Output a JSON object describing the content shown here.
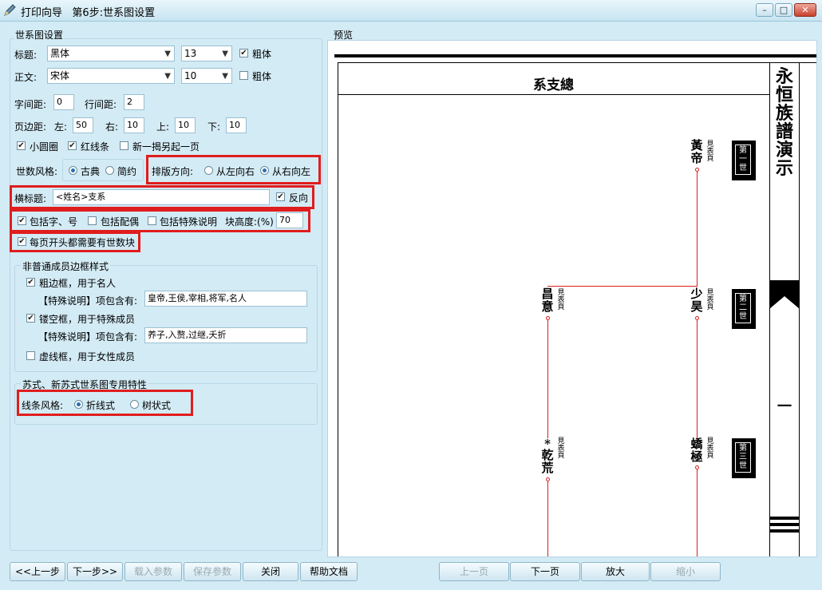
{
  "window": {
    "title": "打印向导",
    "step_title": "第6步:世系图设置",
    "minimize": "–",
    "maximize": "□",
    "close": "✕"
  },
  "settings": {
    "group_label": "世系图设置",
    "title_font": {
      "label": "标题:",
      "font": "黑体",
      "size": "13",
      "bold_label": "粗体",
      "bold": true
    },
    "body_font": {
      "label": "正文:",
      "font": "宋体",
      "size": "10",
      "bold_label": "粗体",
      "bold": false
    },
    "char_spacing": {
      "label": "字间距:",
      "value": "0"
    },
    "line_spacing": {
      "label": "行间距:",
      "value": "2"
    },
    "margins": {
      "label": "页边距:",
      "left_label": "左:",
      "left": "50",
      "right_label": "右:",
      "right": "10",
      "top_label": "上:",
      "top": "10",
      "bottom_label": "下:",
      "bottom": "10"
    },
    "small_circle": {
      "label": "小圆圈",
      "checked": true
    },
    "red_lines": {
      "label": "红线条",
      "checked": true
    },
    "new_page": {
      "label": "新一揭另起一页",
      "checked": false
    },
    "gen_style": {
      "label": "世数风格:",
      "opt1": "古典",
      "opt2": "简约",
      "selected": "古典"
    },
    "direction": {
      "label": "排版方向:",
      "opt1": "从左向右",
      "opt2": "从右向左",
      "selected": "从右向左"
    },
    "header": {
      "label": "横标题:",
      "value": "<姓名>支系",
      "reverse_label": "反向",
      "reverse": true
    },
    "include_names": {
      "label": "包括字、号",
      "checked": true
    },
    "include_spouse": {
      "label": "包括配偶",
      "checked": false
    },
    "include_notes": {
      "label": "包括特殊说明",
      "checked": false
    },
    "block_height": {
      "label": "块高度:(%)",
      "value": "70"
    },
    "gen_block": {
      "label": "每页开头都需要有世数块",
      "checked": true
    }
  },
  "border_styles": {
    "group_label": "非普通成员边框样式",
    "bold_frame": {
      "label": "粗边框，用于名人",
      "checked": true,
      "note_label": "【特殊说明】项包含有:",
      "note_value": "皇帝,王侯,宰相,将军,名人"
    },
    "hollow_frame": {
      "label": "镂空框，用于特殊成员",
      "checked": true,
      "note_label": "【特殊说明】项包含有:",
      "note_value": "养子,入赘,过继,夭折"
    },
    "dashed_frame": {
      "label": "虚线框，用于女性成员",
      "checked": false
    }
  },
  "su_style": {
    "group_label": "苏式、新苏式世系图专用特性",
    "line_style": {
      "label": "线条风格:",
      "opt1": "折线式",
      "opt2": "树状式",
      "selected": "折线式"
    }
  },
  "preview": {
    "label": "预览",
    "header_title": "系支總",
    "side_title": [
      "永",
      "恒",
      "族",
      "譜",
      "演",
      "示"
    ],
    "side_marker": "一",
    "generations": [
      "第一世",
      "第二世",
      "第三世"
    ],
    "persons": [
      {
        "name": "黃帝",
        "note": "見表頁"
      },
      {
        "name": "昌意",
        "note": "見表頁"
      },
      {
        "name": "少昊",
        "note": "見表頁"
      },
      {
        "name": "乾荒",
        "note": "見表頁",
        "mark": "*"
      },
      {
        "name": "蟜極",
        "note": "見表頁"
      }
    ]
  },
  "buttons": {
    "prev_step": "<<上一步",
    "next_step": "下一步>>",
    "load_params": "载入参数",
    "save_params": "保存参数",
    "close": "关闭",
    "help": "帮助文档",
    "prev_page": "上一页",
    "next_page": "下一页",
    "zoom_in": "放大",
    "zoom_out": "缩小"
  }
}
